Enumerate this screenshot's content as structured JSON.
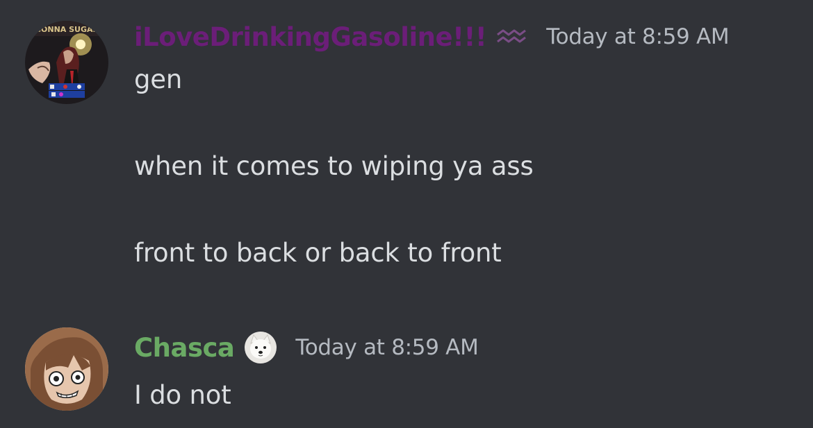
{
  "messages": [
    {
      "author": {
        "name": "iLoveDrinkingGasoline!!!",
        "name_color": "#6b1e78",
        "badge_icon": "aquarius-icon",
        "avatar_icon": "anime-character-avatar"
      },
      "timestamp": "Today at 8:59 AM",
      "lines": [
        "gen",
        "when it comes to wiping ya ass",
        "front to back or back to front"
      ]
    },
    {
      "author": {
        "name": "Chasca",
        "name_color": "#6aaa64",
        "badge_icon": "dog-icon",
        "avatar_icon": "anime-character-avatar"
      },
      "timestamp": "Today at 8:59 AM",
      "lines": [
        "I do not"
      ]
    }
  ],
  "theme": {
    "background": "#313338",
    "text": "#dbdee1",
    "timestamp": "#b5bac1"
  }
}
